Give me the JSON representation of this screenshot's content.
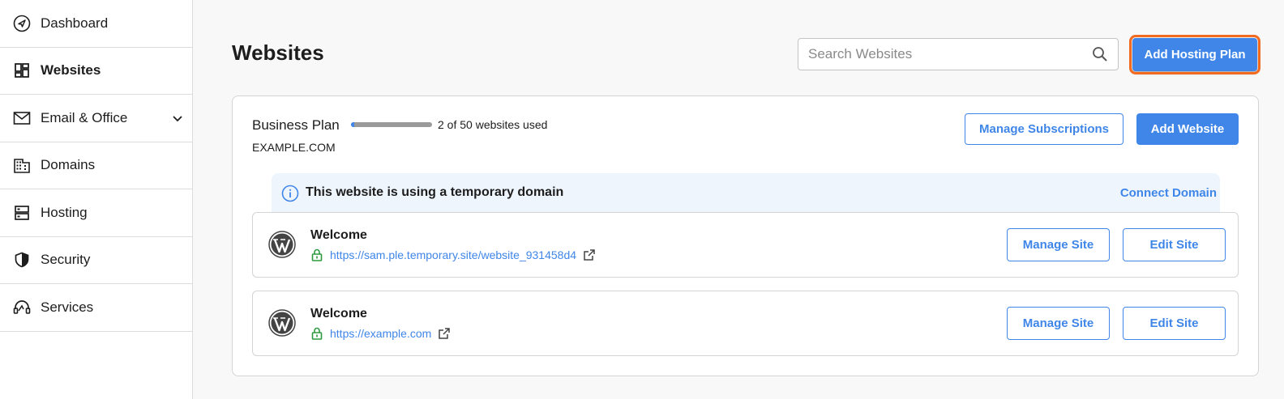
{
  "sidebar": {
    "items": [
      {
        "label": "Dashboard",
        "icon": "compass-icon"
      },
      {
        "label": "Websites",
        "icon": "grid-icon",
        "active": true
      },
      {
        "label": "Email & Office",
        "icon": "mail-icon",
        "expandable": true
      },
      {
        "label": "Domains",
        "icon": "building-icon"
      },
      {
        "label": "Hosting",
        "icon": "server-icon"
      },
      {
        "label": "Security",
        "icon": "shield-icon"
      },
      {
        "label": "Services",
        "icon": "headset-icon"
      }
    ]
  },
  "header": {
    "title": "Websites",
    "search_placeholder": "Search Websites",
    "search_value": "",
    "add_hosting_label": "Add Hosting Plan"
  },
  "plan": {
    "name": "Business Plan",
    "usage_text": "2 of 50 websites used",
    "usage_used": 2,
    "usage_total": 50,
    "domain": "EXAMPLE.COM",
    "manage_subscriptions_label": "Manage Subscriptions",
    "add_website_label": "Add Website"
  },
  "banner": {
    "text": "This website is using a temporary domain",
    "connect_label": "Connect Domain"
  },
  "sites": [
    {
      "name": "Welcome",
      "url": "https://sam.ple.temporary.site/website_931458d4",
      "manage_label": "Manage Site",
      "edit_label": "Edit Site"
    },
    {
      "name": "Welcome",
      "url": "https://example.com",
      "manage_label": "Manage Site",
      "edit_label": "Edit Site"
    }
  ],
  "colors": {
    "accent": "#3f86e8",
    "highlight": "#f26b21",
    "secure": "#2e9a3f"
  }
}
